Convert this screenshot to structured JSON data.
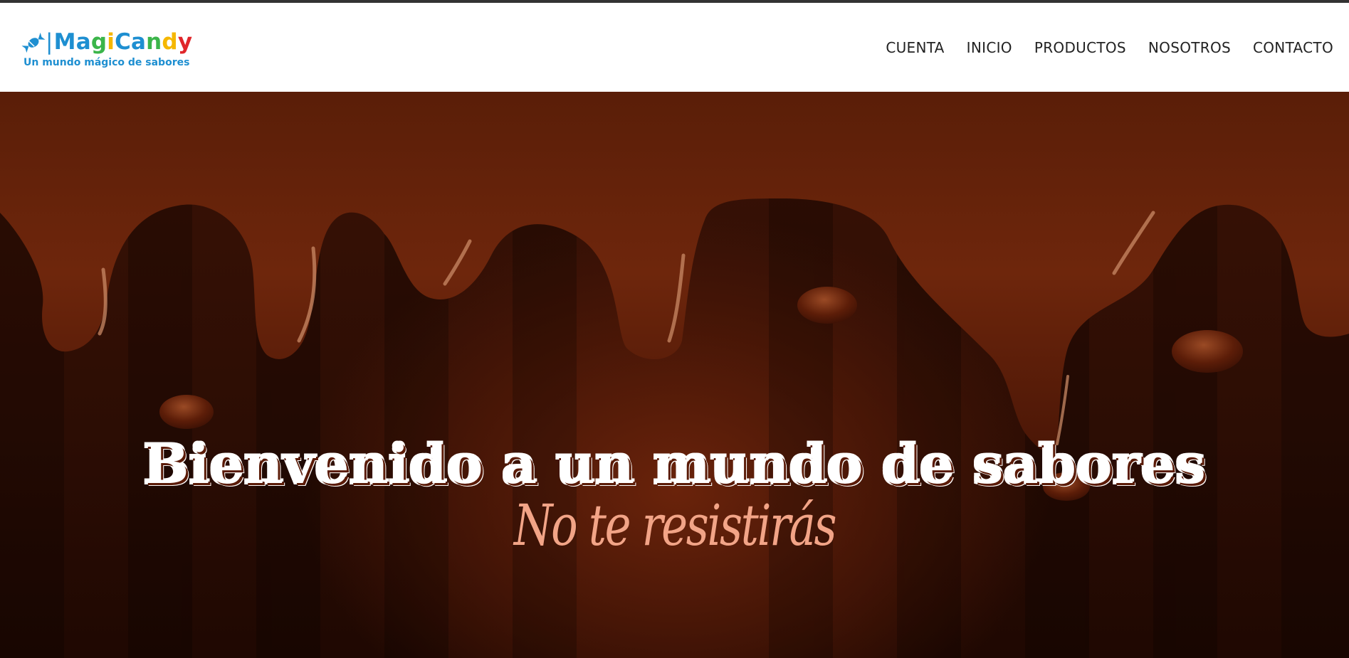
{
  "brand": {
    "name_parts": [
      {
        "text": "M",
        "color": "#1e8fd1"
      },
      {
        "text": "a",
        "color": "#1e8fd1"
      },
      {
        "text": "g",
        "color": "#3bb54a"
      },
      {
        "text": "i",
        "color": "#f5b700"
      },
      {
        "text": "C",
        "color": "#1e8fd1"
      },
      {
        "text": "a",
        "color": "#1e8fd1"
      },
      {
        "text": "n",
        "color": "#3bb54a"
      },
      {
        "text": "d",
        "color": "#f5b700"
      },
      {
        "text": "y",
        "color": "#e0262a"
      }
    ],
    "tagline": "Un mundo mágico de sabores",
    "tagline_color": "#1e8fd1",
    "icon": "candy-icon"
  },
  "nav": {
    "items": [
      {
        "label": "CUENTA"
      },
      {
        "label": "INICIO"
      },
      {
        "label": "PRODUCTOS"
      },
      {
        "label": "NOSOTROS"
      },
      {
        "label": "CONTACTO"
      }
    ]
  },
  "hero": {
    "title": "Bienvenido a un mundo de sabores",
    "subtitle": "No te resistirás",
    "subtitle_color": "#f2a487",
    "background": "melting-chocolate"
  }
}
